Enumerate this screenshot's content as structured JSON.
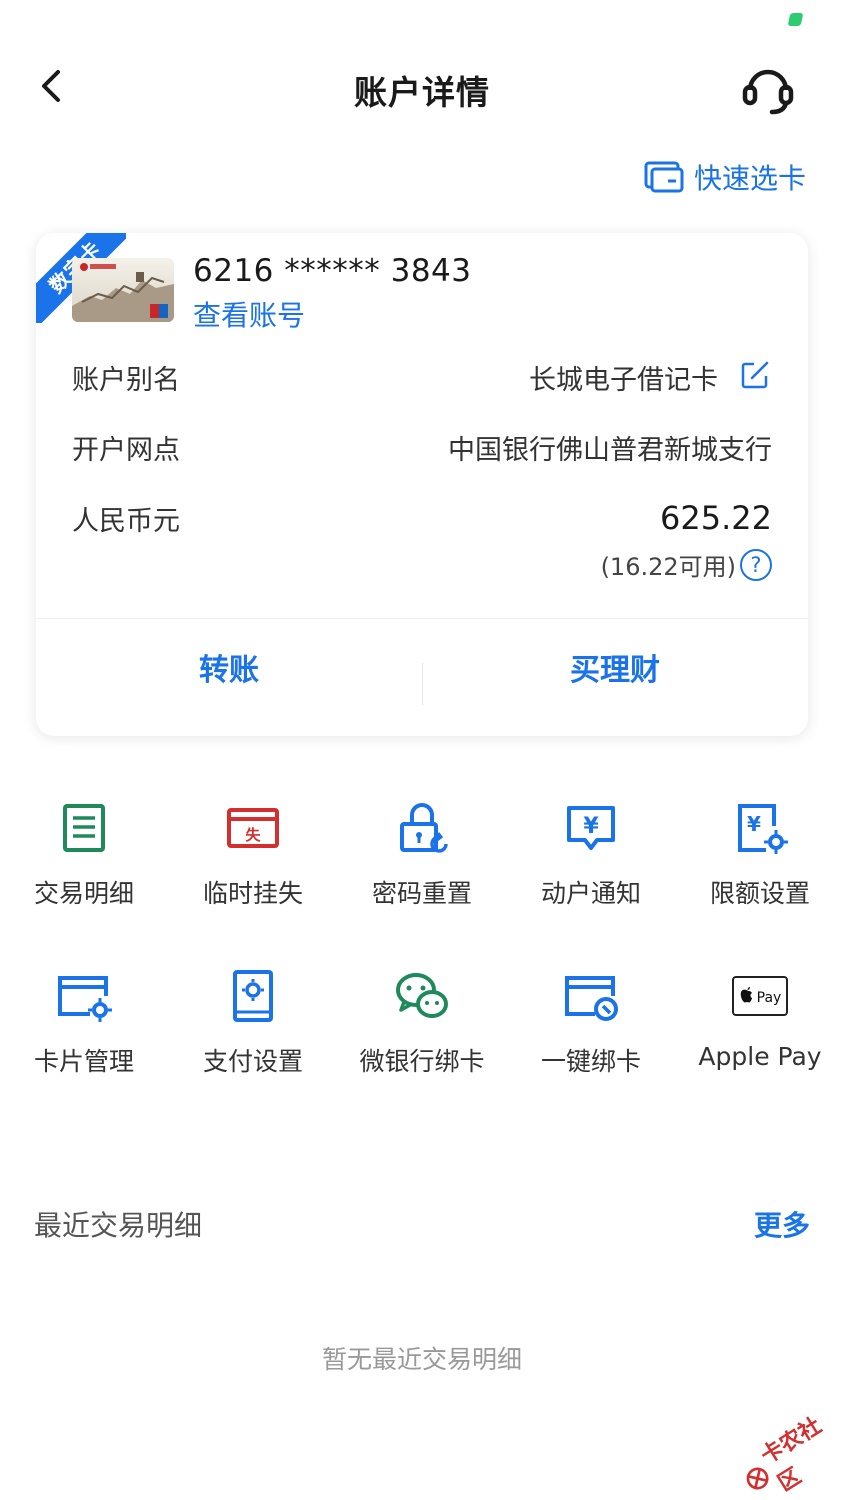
{
  "header": {
    "title": "账户详情"
  },
  "quick_select": {
    "label": "快速选卡"
  },
  "card": {
    "badge": "数字卡",
    "number": "6216 ****** 3843",
    "view_account": "查看账号",
    "alias_label": "账户别名",
    "alias_value": "长城电子借记卡",
    "branch_label": "开户网点",
    "branch_value": "中国银行佛山普君新城支行",
    "currency_label": "人民币元",
    "balance": "625.22",
    "available": "(16.22可用)",
    "help_icon": "?"
  },
  "actions": {
    "transfer": "转账",
    "buy_finance": "买理财"
  },
  "services": [
    {
      "label": "交易明细",
      "icon": "list-doc-icon",
      "color": "#1e8a5c"
    },
    {
      "label": "临时挂失",
      "icon": "card-lost-icon",
      "color": "#d32f2f"
    },
    {
      "label": "密码重置",
      "icon": "lock-reset-icon",
      "color": "#1a73e8"
    },
    {
      "label": "动户通知",
      "icon": "yuan-notify-icon",
      "color": "#1a73e8"
    },
    {
      "label": "限额设置",
      "icon": "limit-settings-icon",
      "color": "#1a73e8"
    },
    {
      "label": "卡片管理",
      "icon": "card-manage-icon",
      "color": "#1a73e8"
    },
    {
      "label": "支付设置",
      "icon": "pay-settings-icon",
      "color": "#1a73e8"
    },
    {
      "label": "微银行绑卡",
      "icon": "wechat-bind-icon",
      "color": "#1e8a5c"
    },
    {
      "label": "一键绑卡",
      "icon": "one-click-bind-icon",
      "color": "#1a73e8"
    },
    {
      "label": "Apple Pay",
      "icon": "apple-pay-icon",
      "color": "#111111"
    }
  ],
  "apple_pay_badge": "Pay",
  "recent": {
    "title": "最近交易明细",
    "more": "更多",
    "empty": "暂无最近交易明细"
  },
  "watermark": {
    "text": "卡农社区"
  }
}
